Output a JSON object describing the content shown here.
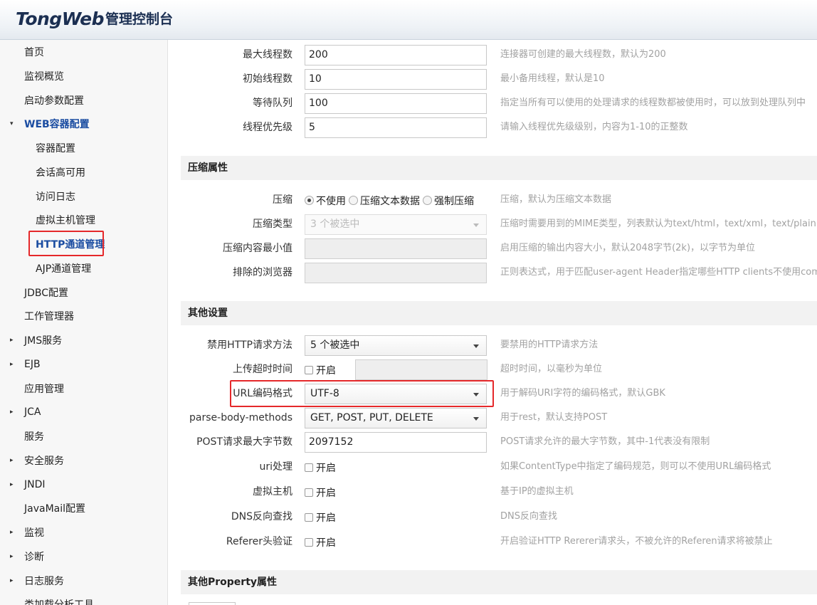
{
  "header": {
    "logo_main": "TongWeb",
    "logo_sub": "管理控制台"
  },
  "sidebar": {
    "items": [
      {
        "label": "首页",
        "arrow": ""
      },
      {
        "label": "监视概览",
        "arrow": ""
      },
      {
        "label": "启动参数配置",
        "arrow": ""
      },
      {
        "label": "WEB容器配置",
        "arrow": "▾"
      },
      {
        "label": "容器配置",
        "arrow": ""
      },
      {
        "label": "会话高可用",
        "arrow": ""
      },
      {
        "label": "访问日志",
        "arrow": ""
      },
      {
        "label": "虚拟主机管理",
        "arrow": ""
      },
      {
        "label": "HTTP通道管理",
        "arrow": ""
      },
      {
        "label": "AJP通道管理",
        "arrow": ""
      },
      {
        "label": "JDBC配置",
        "arrow": ""
      },
      {
        "label": "工作管理器",
        "arrow": ""
      },
      {
        "label": "JMS服务",
        "arrow": "▸"
      },
      {
        "label": "EJB",
        "arrow": "▸"
      },
      {
        "label": "应用管理",
        "arrow": ""
      },
      {
        "label": "JCA",
        "arrow": "▸"
      },
      {
        "label": "服务",
        "arrow": ""
      },
      {
        "label": "安全服务",
        "arrow": "▸"
      },
      {
        "label": "JNDI",
        "arrow": "▸"
      },
      {
        "label": "JavaMail配置",
        "arrow": ""
      },
      {
        "label": "监视",
        "arrow": "▸"
      },
      {
        "label": "诊断",
        "arrow": "▸"
      },
      {
        "label": "日志服务",
        "arrow": "▸"
      },
      {
        "label": "类加载分析工具",
        "arrow": ""
      }
    ]
  },
  "form": {
    "max_threads": {
      "label": "最大线程数",
      "value": "200",
      "desc": "连接器可创建的最大线程数，默认为200"
    },
    "min_threads": {
      "label": "初始线程数",
      "value": "10",
      "desc": "最小备用线程，默认是10"
    },
    "accept_queue": {
      "label": "等待队列",
      "value": "100",
      "desc": "指定当所有可以使用的处理请求的线程数都被使用时，可以放到处理队列中"
    },
    "thread_priority": {
      "label": "线程优先级",
      "value": "5",
      "desc": "请输入线程优先级级别，内容为1-10的正整数"
    },
    "section_compress": "压缩属性",
    "compression": {
      "label": "压缩",
      "options": [
        "不使用",
        "压缩文本数据",
        "强制压缩"
      ],
      "selected": "不使用",
      "desc": "压缩，默认为压缩文本数据"
    },
    "compression_type": {
      "label": "压缩类型",
      "value": "3 个被选中",
      "desc": "压缩时需要用到的MIME类型，列表默认为text/html，text/xml，text/plain"
    },
    "compression_min": {
      "label": "压缩内容最小值",
      "value": "",
      "desc": "启用压缩的输出内容大小，默认2048字节(2k)，以字节为单位"
    },
    "excluded_browsers": {
      "label": "排除的浏览器",
      "value": "",
      "desc": "正则表达式，用于匹配user-agent Header指定哪些HTTP clients不使用com"
    },
    "section_other": "其他设置",
    "disabled_methods": {
      "label": "禁用HTTP请求方法",
      "value": "5 个被选中",
      "desc": "要禁用的HTTP请求方法"
    },
    "upload_timeout": {
      "label": "上传超时时间",
      "check_label": "开启",
      "desc": "超时时间，以毫秒为单位"
    },
    "url_encoding": {
      "label": "URL编码格式",
      "value": "UTF-8",
      "desc": "用于解码URI字符的编码格式，默认GBK"
    },
    "parse_body_methods": {
      "label": "parse-body-methods",
      "value": "GET, POST, PUT, DELETE",
      "desc": "用于rest，默认支持POST"
    },
    "max_post_size": {
      "label": "POST请求最大字节数",
      "value": "2097152",
      "desc": "POST请求允许的最大字节数，其中-1代表没有限制"
    },
    "uri_handling": {
      "label": "uri处理",
      "check_label": "开启",
      "desc": "如果ContentType中指定了编码规范，则可以不使用URL编码格式"
    },
    "virtual_host": {
      "label": "虚拟主机",
      "check_label": "开启",
      "desc": "基于IP的虚拟主机"
    },
    "dns_lookup": {
      "label": "DNS反向查找",
      "check_label": "开启",
      "desc": "DNS反向查找"
    },
    "referer_check": {
      "label": "Referer头验证",
      "check_label": "开启",
      "desc": "开启验证HTTP Rererer请求头，不被允许的Referen请求将被禁止"
    },
    "section_property": "其他Property属性"
  },
  "colors": {
    "highlight": "#e5282a",
    "active_nav": "#1a4ca1"
  }
}
